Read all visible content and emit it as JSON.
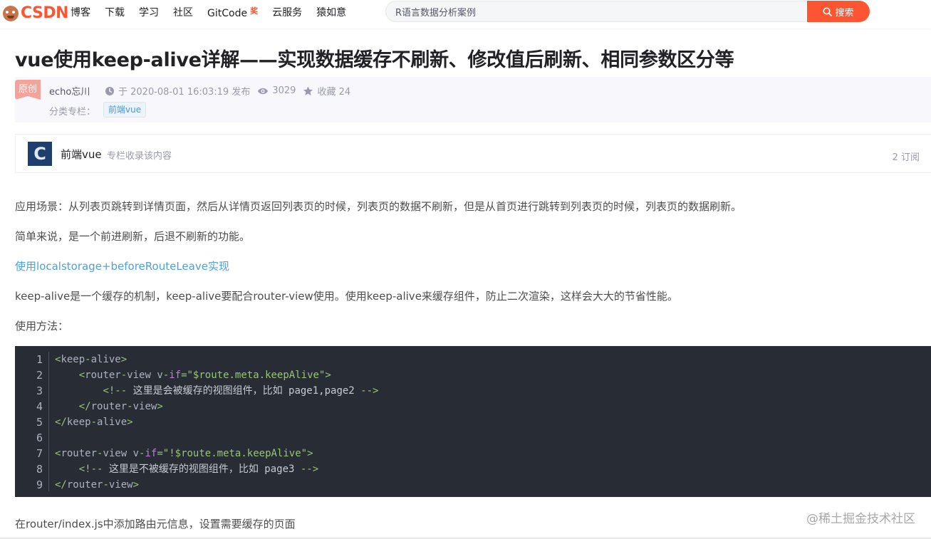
{
  "header": {
    "logo_text": "CSDN",
    "nav": [
      "博客",
      "下载",
      "学习",
      "社区",
      "GitCode",
      "云服务",
      "猿如意"
    ],
    "gitcode_badge": "奖",
    "search_value": "R语言数据分析案例",
    "search_button": "搜索"
  },
  "article": {
    "title": "vue使用keep-alive详解——实现数据缓存不刷新、修改值后刷新、相同参数区分等",
    "original_badge": "原创",
    "author": "echo忘川",
    "published": "于 2020-08-01 16:03:19 发布",
    "views": "3029",
    "favorites": "收藏 24",
    "category_label": "分类专栏：",
    "category_tag": "前端vue"
  },
  "column": {
    "avatar_letter": "C",
    "name": "前端vue",
    "desc": "专栏收录该内容",
    "subscribers": "2 订阅"
  },
  "content": {
    "p1": "应用场景：从列表页跳转到详情页面，然后从详情页返回列表页的时候，列表页的数据不刷新，但是从首页进行跳转到列表页的时候，列表页的数据刷新。",
    "p2": "简单来说，是一个前进刷新，后退不刷新的功能。",
    "link": "使用localstorage+beforeRouteLeave实现",
    "p3": "keep-alive是一个缓存的机制，keep-alive要配合router-view使用。使用keep-alive来缓存组件，防止二次渲染，这样会大大的节省性能。",
    "p4": "使用方法：",
    "p5": "在router/index.js中添加路由元信息，设置需要缓存的页面"
  },
  "code": {
    "line_numbers": [
      "1",
      "2",
      "3",
      "4",
      "5",
      "6",
      "7",
      "8",
      "9"
    ],
    "comment1": "这里是会被缓存的视图组件，比如 page1,page2",
    "comment2": "这里是不被缓存的视图组件，比如 page3"
  },
  "watermark": "@稀土掘金技术社区",
  "colors": {
    "brand": "#fc5531",
    "link": "#4ea1db",
    "code_bg": "#282c34"
  }
}
